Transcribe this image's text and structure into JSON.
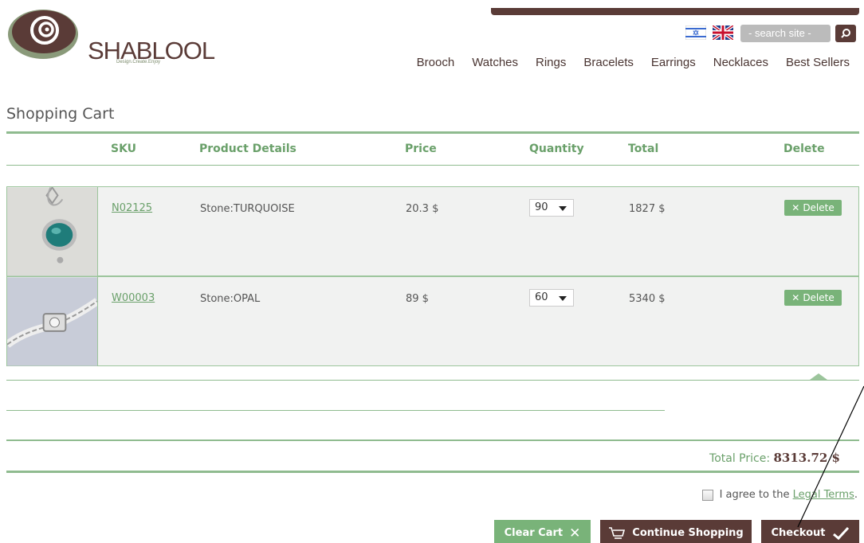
{
  "brand": {
    "name": "SHABLOOL",
    "tagline": "Design.Create.Enjoy"
  },
  "search": {
    "placeholder": "- search site -"
  },
  "nav": {
    "items": [
      "Brooch",
      "Watches",
      "Rings",
      "Bracelets",
      "Earrings",
      "Necklaces",
      "Best Sellers"
    ]
  },
  "page": {
    "title": "Shopping Cart"
  },
  "table": {
    "headers": {
      "sku": "SKU",
      "details": "Product Details",
      "price": "Price",
      "quantity": "Quantity",
      "total": "Total",
      "delete": "Delete"
    },
    "rows": [
      {
        "sku": "N02125",
        "details": "Stone:TURQUOISE",
        "price": "20.3 $",
        "quantity": "90",
        "total": "1827 $",
        "delete_label": "Delete"
      },
      {
        "sku": "W00003",
        "details": "Stone:OPAL",
        "price": "89 $",
        "quantity": "60",
        "total": "5340 $",
        "delete_label": "Delete"
      }
    ]
  },
  "summary": {
    "total_label": "Total Price:",
    "total_value": "8313.72 $"
  },
  "terms": {
    "text": "I agree to the",
    "link": "Legal Terms",
    "suffix": "."
  },
  "buttons": {
    "clear": "Clear Cart",
    "continue": "Continue Shopping",
    "checkout": "Checkout"
  },
  "colors": {
    "brown": "#5a3b37",
    "green": "#79b379",
    "green_text": "#6aa06a",
    "row_bg": "#f1f2f1"
  }
}
